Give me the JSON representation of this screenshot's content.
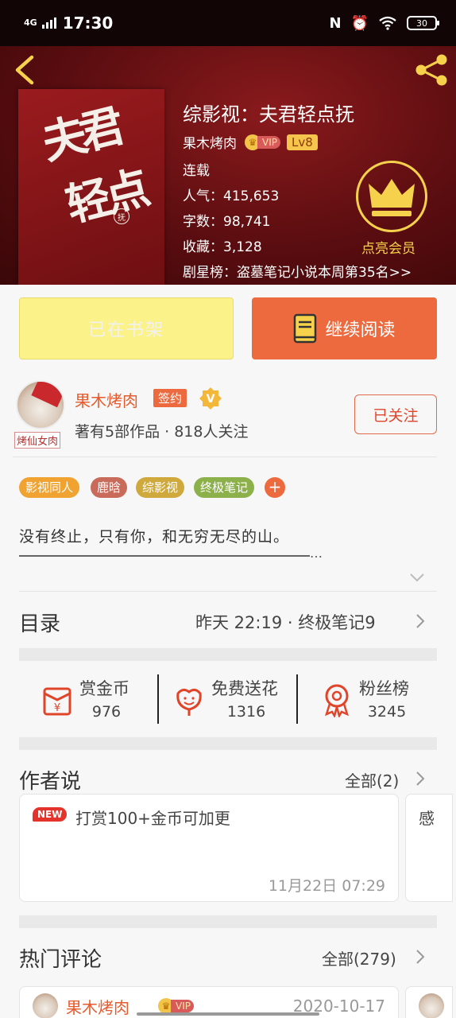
{
  "status_bar": {
    "network": "4G",
    "time": "17:30",
    "battery": "30"
  },
  "book": {
    "title": "综影视：夫君轻点抚",
    "author": "果木烤肉",
    "vip_text": "VIP",
    "level": "Lv8",
    "status": "连载",
    "popularity": "人气：415,653",
    "word_count": "字数：98,741",
    "favorites": "收藏：3,128",
    "ranking": "剧星榜：盗墓笔记小说本周第35名>>",
    "vip_member_label": "点亮会员",
    "cover_line1": "夫君",
    "cover_line2": "轻点",
    "cover_seal": "抚"
  },
  "actions": {
    "shelf_label": "已在书架",
    "read_label": "继续阅读"
  },
  "author": {
    "name": "果木烤肉",
    "sign_badge": "签约",
    "v_badge": "V",
    "stats": "著有5部作品 · 818人关注",
    "follow_label": "已关注",
    "avatar_tag": "烤仙女肉"
  },
  "tags": [
    {
      "label": "影视同人",
      "color": "#f0a330"
    },
    {
      "label": "鹿晗",
      "color": "#c96b5a"
    },
    {
      "label": "综影视",
      "color": "#cfa93c"
    },
    {
      "label": "终极笔记",
      "color": "#8cb04a"
    }
  ],
  "tag_add": "+",
  "summary": "没有终止，只有你，和无穷无尽的山。",
  "summary_ellipsis": "…",
  "toc": {
    "title": "目录",
    "latest": "昨天 22:19 · 终极笔记9"
  },
  "support": [
    {
      "label": "赏金币",
      "value": "976"
    },
    {
      "label": "免费送花",
      "value": "1316"
    },
    {
      "label": "粉丝榜",
      "value": "3245"
    }
  ],
  "author_says": {
    "title": "作者说",
    "all": "全部(2)",
    "cards": [
      {
        "badge": "NEW",
        "text": "打赏100+金币可加更",
        "time": "11月22日  07:29"
      },
      {
        "text": "感"
      }
    ]
  },
  "hot_comments": {
    "title": "热门评论",
    "all": "全部(279)",
    "items": [
      {
        "user": "果木烤肉",
        "vip": "VIP",
        "date": "2020-10-17"
      }
    ]
  },
  "colors": {
    "accent": "#ec6a3e",
    "shelf_button": "#fbf28a",
    "vip_gold": "#f6d24c"
  }
}
